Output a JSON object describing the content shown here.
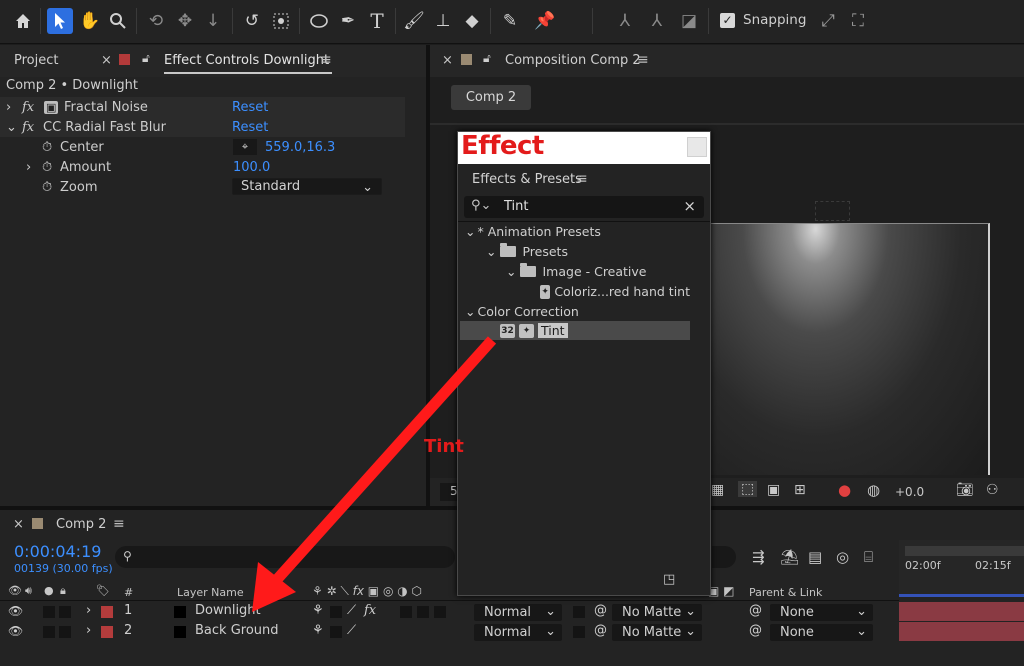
{
  "toolbar": {
    "tools": [
      "home-icon",
      "selection-tool-icon",
      "hand-tool-icon",
      "zoom-tool-icon",
      "orbit-camera-icon",
      "pan-camera-icon",
      "dolly-camera-icon",
      "rotate-tool-icon",
      "anchor-point-tool-icon",
      "ellipse-tool-icon",
      "pen-tool-icon",
      "type-tool-icon",
      "brush-tool-icon",
      "clone-stamp-icon",
      "eraser-tool-icon",
      "roto-brush-icon",
      "puppet-pin-icon"
    ],
    "snapping_label": "Snapping",
    "snapping_checked": true
  },
  "left_panel": {
    "tab_project": "Project",
    "tab_effect_controls": "Effect Controls Downlight",
    "breadcrumb": "Comp 2 • Downlight",
    "effects": [
      {
        "name": "Fractal Noise",
        "reset": "Reset"
      },
      {
        "name": "CC Radial Fast Blur",
        "reset": "Reset"
      }
    ],
    "props": {
      "center_label": "Center",
      "center_value": "559.0,16.3",
      "amount_label": "Amount",
      "amount_value": "100.0",
      "zoom_label": "Zoom",
      "zoom_value": "Standard"
    }
  },
  "comp_panel": {
    "tab": "Composition Comp 2",
    "breadcrumb_button": "Comp 2",
    "bottom_left": "5",
    "exposure_value": "+0.0"
  },
  "effect_window": {
    "title": "Effect",
    "panel_tab": "Effects & Presets",
    "search_value": "Tint",
    "tree": [
      {
        "label": "* Animation Presets",
        "level": 0,
        "kind": "category"
      },
      {
        "label": "Presets",
        "level": 1,
        "kind": "folder"
      },
      {
        "label": "Image - Creative",
        "level": 2,
        "kind": "folder"
      },
      {
        "label": "Coloriz...red hand tint",
        "level": 3,
        "kind": "preset"
      },
      {
        "label": "Color Correction",
        "level": 0,
        "kind": "category"
      },
      {
        "label": "Tint",
        "level": 1,
        "kind": "effect",
        "badge": "32",
        "selected": true
      }
    ]
  },
  "annotation": {
    "label": "Tint",
    "arrow_color": "#ff1a1a"
  },
  "timeline": {
    "tab": "Comp 2",
    "timecode": "0:00:04:19",
    "frames_fps": "00139 (30.00 fps)",
    "ruler": [
      "02:00f",
      "02:15f"
    ],
    "headers": {
      "num": "#",
      "layer_name": "Layer Name",
      "parent_link": "Parent & Link"
    },
    "layers": [
      {
        "num": "1",
        "name": "Downlight",
        "mode": "Normal",
        "matte": "No Matte",
        "parent": "None",
        "has_fx": true
      },
      {
        "num": "2",
        "name": "Back Ground",
        "mode": "Normal",
        "matte": "No Matte",
        "parent": "None",
        "has_fx": false
      }
    ]
  },
  "colors": {
    "accent_blue": "#2d6fe0",
    "link_blue": "#3c8fff",
    "layer_red": "#b43c3c",
    "bar_color": "#8a3a43"
  }
}
